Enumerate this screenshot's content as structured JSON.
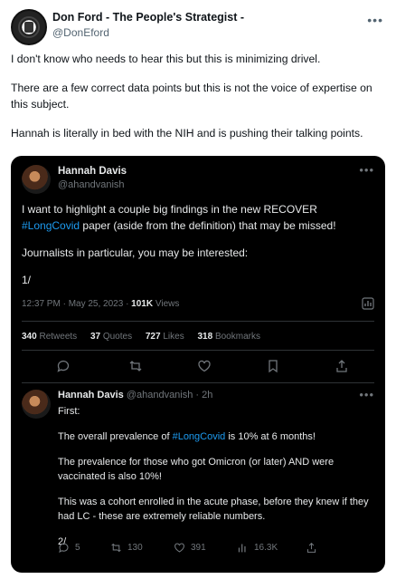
{
  "outer": {
    "display_name": "Don Ford - The People's Strategist -",
    "handle": "@DonEford",
    "paragraphs": [
      "I don't know who needs to hear this but this is minimizing drivel.",
      "There are a few correct data points but this is not the voice of expertise on this subject.",
      "Hannah is literally in bed with the NIH and is pushing their talking points."
    ]
  },
  "quoted": {
    "display_name": "Hannah Davis",
    "handle": "@ahandvanish",
    "body_line1_pre": "I want to highlight a couple big findings in the new RECOVER ",
    "body_hashtag": "#LongCovid",
    "body_line1_post": " paper (aside from the definition) that may be missed!",
    "body_p2": "Journalists in particular, you may be interested:",
    "body_p3": "1/",
    "timestamp": "12:37 PM · May 25, 2023 · ",
    "views_count": "101K",
    "views_label": " Views",
    "stats": {
      "retweets_count": "340",
      "retweets_label": "Retweets",
      "quotes_count": "37",
      "quotes_label": "Quotes",
      "likes_count": "727",
      "likes_label": "Likes",
      "bookmarks_count": "318",
      "bookmarks_label": "Bookmarks"
    }
  },
  "reply": {
    "display_name": "Hannah Davis",
    "handle_time": "@ahandvanish · 2h",
    "p1": "First:",
    "p2_pre": "The overall prevalence of ",
    "p2_hashtag": "#LongCovid",
    "p2_post": " is 10% at 6 months!",
    "p3": "The prevalence for those who got Omicron (or later) AND were vaccinated is also 10%!",
    "p4": "This was a cohort enrolled in the acute phase, before they knew if they had LC - these are extremely reliable numbers.",
    "p5": "2/",
    "actions": {
      "replies": "5",
      "retweets": "130",
      "likes": "391",
      "views": "16.3K"
    }
  },
  "colors": {
    "link": "#1d9bf0",
    "card_bg": "#000000",
    "muted": "#71767b"
  }
}
